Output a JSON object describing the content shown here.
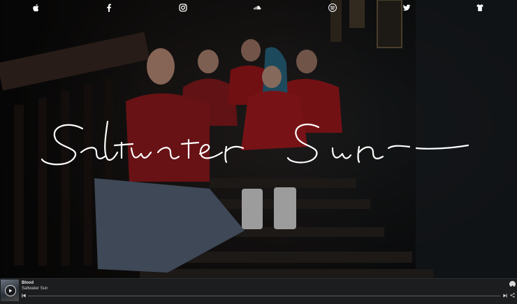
{
  "nav": {
    "icons": [
      "apple-music-icon",
      "facebook-icon",
      "instagram-icon",
      "soundcloud-icon",
      "spotify-icon",
      "twitter-icon",
      "merch-tshirt-icon"
    ]
  },
  "hero": {
    "logo_text": "Saltwater Sun"
  },
  "player": {
    "track_title": "Blood",
    "track_artist": "Saltwater Sun",
    "progress": 0.0
  },
  "colors": {
    "background": "#141414",
    "player_bg": "#1b1d1f",
    "logo": "#ffffff"
  }
}
